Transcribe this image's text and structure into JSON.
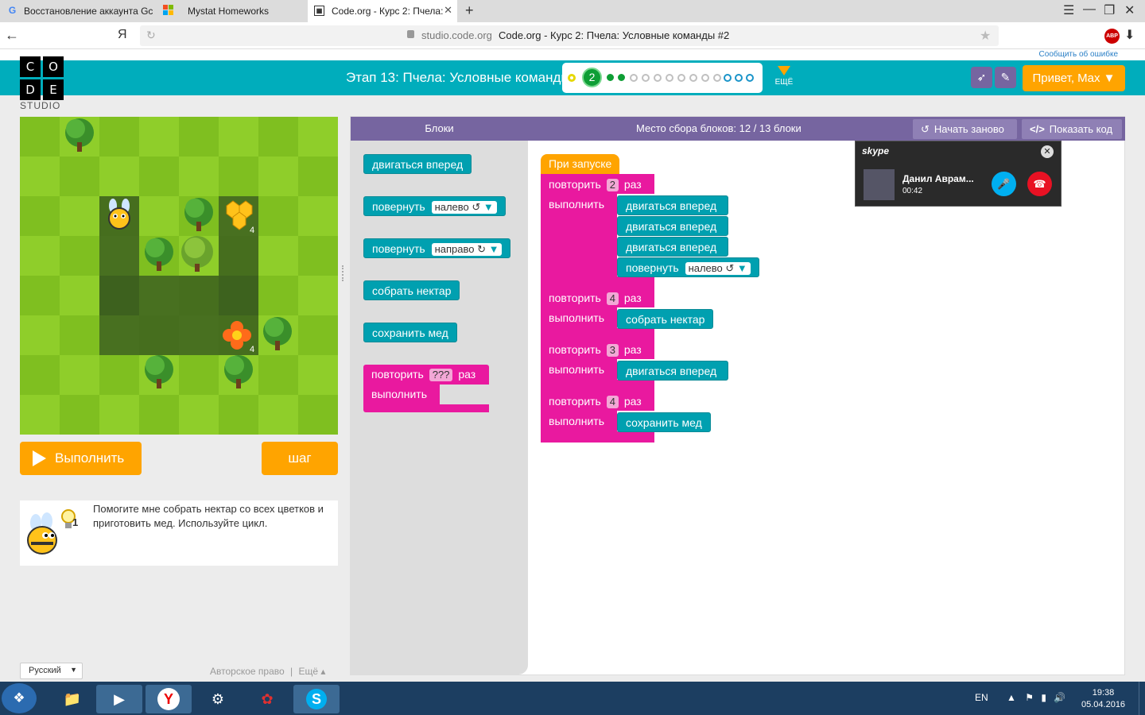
{
  "browser": {
    "tabs": [
      {
        "label": "Восстановление аккаунта Gc",
        "icon": "google-icon"
      },
      {
        "label": "Mystat Homeworks",
        "icon": "windows-icon"
      },
      {
        "label": "Code.org - Курс 2: Пчела:",
        "icon": "codeorg-icon"
      }
    ],
    "new_tab": "+",
    "ya": "Я",
    "domain": "studio.code.org",
    "page_title": "Code.org - Курс 2: Пчела: Условные команды #2",
    "abp": "ABP"
  },
  "header": {
    "report_link": "Сообщить об ошибке",
    "logo_letters": [
      "C",
      "O",
      "D",
      "E"
    ],
    "studio": "STUDIO",
    "stage_title": "Этап 13: Пчела: Условные команды",
    "current_level": "2",
    "more_label": "ЕЩЁ",
    "hello_button": "Привет, Max ▼",
    "accent": "#00adbc"
  },
  "game": {
    "run_button": "Выполнить",
    "step_button": "шаг",
    "honey_count": "4",
    "flower_count": "4"
  },
  "instructions": {
    "text": "Помогите мне собрать нектар со всех цветков и приготовить мед. Используйте цикл.",
    "hint_count": "1"
  },
  "footer": {
    "language": "Русский",
    "copyright": "Авторское право",
    "more": "Ещё ▴"
  },
  "workspace": {
    "toolbox_title": "Блоки",
    "counter": "Место сбора блоков: 12 / 13 блоки",
    "restart_button": "Начать заново",
    "show_code_button": "Показать код",
    "toolbox": {
      "move_forward": "двигаться вперед",
      "turn": "повернуть",
      "left": "налево ↺",
      "right": "направо ↻",
      "collect_nectar": "собрать нектар",
      "make_honey": "сохранить мед",
      "repeat": "повторить",
      "repeat_placeholder": "???",
      "times": "раз",
      "do": "выполнить"
    },
    "program": {
      "when_run": "При запуске",
      "repeat": "повторить",
      "times": "раз",
      "do": "выполнить",
      "loop1_count": "2",
      "loop2_count": "4",
      "loop3_count": "3",
      "loop4_count": "4",
      "move_forward": "двигаться вперед",
      "turn": "повернуть",
      "left": "налево ↺",
      "collect_nectar": "собрать нектар",
      "make_honey": "сохранить мед"
    }
  },
  "skype": {
    "logo": "skype",
    "caller": "Данил Аврам...",
    "duration": "00:42"
  },
  "taskbar": {
    "lang": "EN",
    "time": "19:38",
    "date": "05.04.2016"
  }
}
